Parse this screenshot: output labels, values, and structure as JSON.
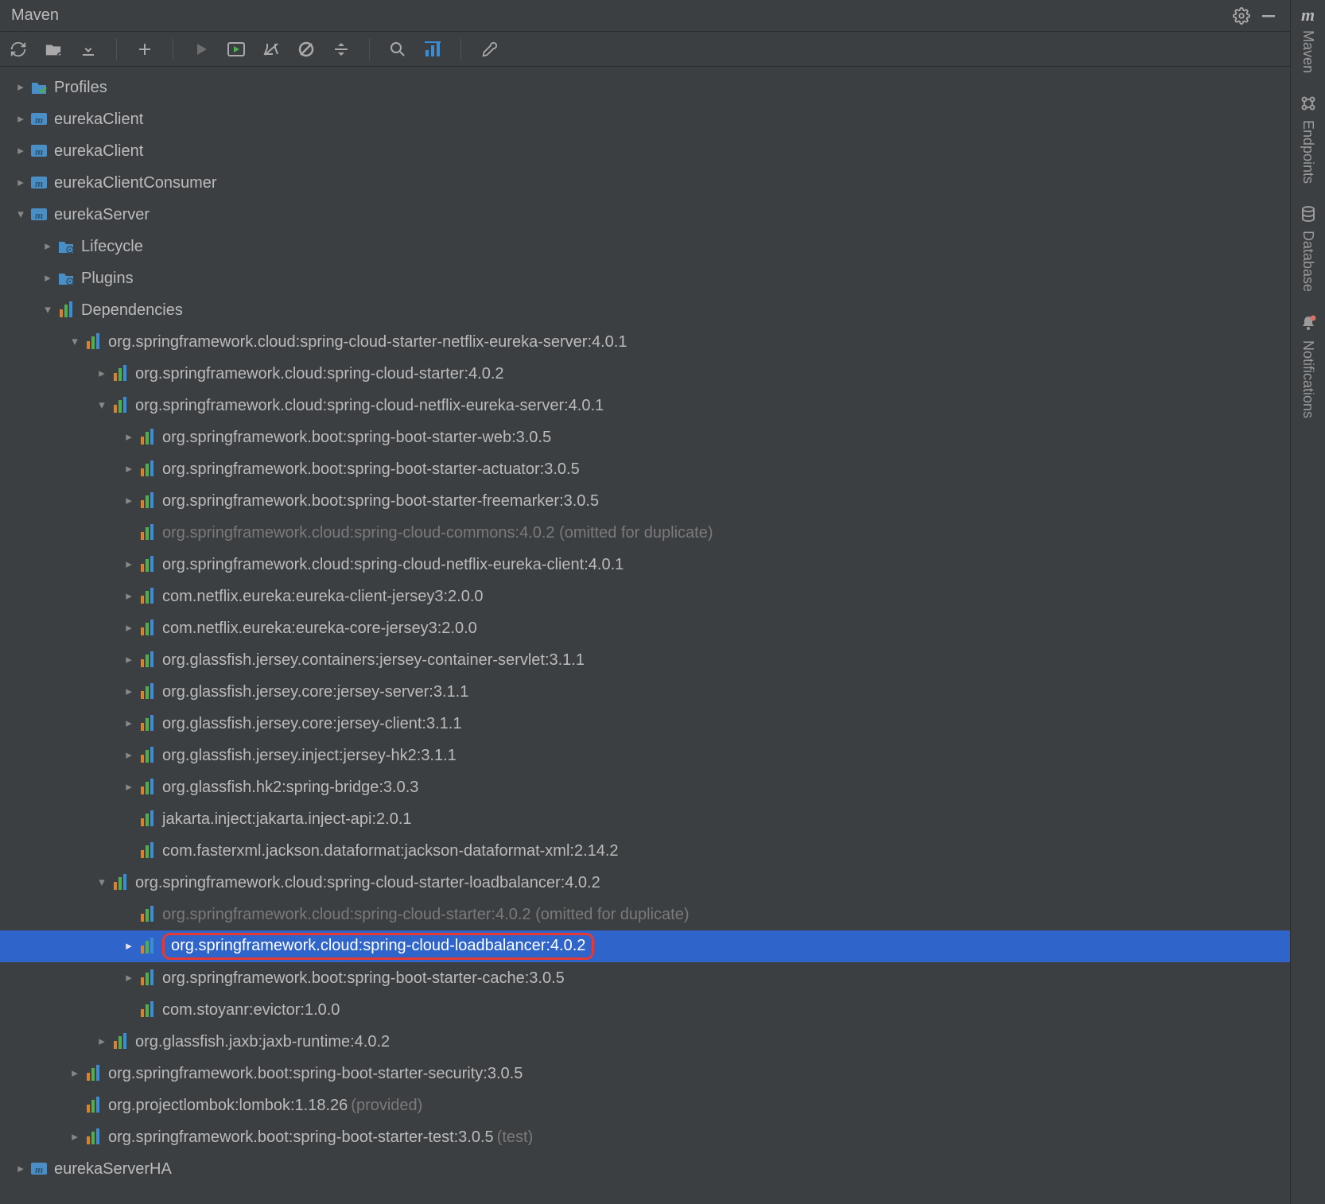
{
  "panel": {
    "title": "Maven"
  },
  "rightbar": {
    "tabs": [
      "Maven",
      "Endpoints",
      "Database",
      "Notifications"
    ]
  },
  "tree": [
    {
      "depth": 0,
      "arrow": "right",
      "icon": "folder-check",
      "label": "Profiles"
    },
    {
      "depth": 0,
      "arrow": "right",
      "icon": "maven-module",
      "label": "eurekaClient"
    },
    {
      "depth": 0,
      "arrow": "right",
      "icon": "maven-module",
      "label": "eurekaClient"
    },
    {
      "depth": 0,
      "arrow": "right",
      "icon": "maven-module",
      "label": "eurekaClientConsumer"
    },
    {
      "depth": 0,
      "arrow": "down",
      "icon": "maven-module",
      "label": "eurekaServer"
    },
    {
      "depth": 1,
      "arrow": "right",
      "icon": "folder-gear",
      "label": "Lifecycle"
    },
    {
      "depth": 1,
      "arrow": "right",
      "icon": "folder-gear",
      "label": "Plugins"
    },
    {
      "depth": 1,
      "arrow": "down",
      "icon": "bars",
      "label": "Dependencies"
    },
    {
      "depth": 2,
      "arrow": "down",
      "icon": "bars",
      "label": "org.springframework.cloud:spring-cloud-starter-netflix-eureka-server:4.0.1"
    },
    {
      "depth": 3,
      "arrow": "right",
      "icon": "bars",
      "label": "org.springframework.cloud:spring-cloud-starter:4.0.2"
    },
    {
      "depth": 3,
      "arrow": "down",
      "icon": "bars",
      "label": "org.springframework.cloud:spring-cloud-netflix-eureka-server:4.0.1"
    },
    {
      "depth": 4,
      "arrow": "right",
      "icon": "bars",
      "label": "org.springframework.boot:spring-boot-starter-web:3.0.5"
    },
    {
      "depth": 4,
      "arrow": "right",
      "icon": "bars",
      "label": "org.springframework.boot:spring-boot-starter-actuator:3.0.5"
    },
    {
      "depth": 4,
      "arrow": "right",
      "icon": "bars",
      "label": "org.springframework.boot:spring-boot-starter-freemarker:3.0.5"
    },
    {
      "depth": 4,
      "arrow": "blank",
      "icon": "bars",
      "label": "org.springframework.cloud:spring-cloud-commons:4.0.2 (omitted for duplicate)",
      "dimmed": true
    },
    {
      "depth": 4,
      "arrow": "right",
      "icon": "bars",
      "label": "org.springframework.cloud:spring-cloud-netflix-eureka-client:4.0.1"
    },
    {
      "depth": 4,
      "arrow": "right",
      "icon": "bars",
      "label": "com.netflix.eureka:eureka-client-jersey3:2.0.0"
    },
    {
      "depth": 4,
      "arrow": "right",
      "icon": "bars",
      "label": "com.netflix.eureka:eureka-core-jersey3:2.0.0"
    },
    {
      "depth": 4,
      "arrow": "right",
      "icon": "bars",
      "label": "org.glassfish.jersey.containers:jersey-container-servlet:3.1.1"
    },
    {
      "depth": 4,
      "arrow": "right",
      "icon": "bars",
      "label": "org.glassfish.jersey.core:jersey-server:3.1.1"
    },
    {
      "depth": 4,
      "arrow": "right",
      "icon": "bars",
      "label": "org.glassfish.jersey.core:jersey-client:3.1.1"
    },
    {
      "depth": 4,
      "arrow": "right",
      "icon": "bars",
      "label": "org.glassfish.jersey.inject:jersey-hk2:3.1.1"
    },
    {
      "depth": 4,
      "arrow": "right",
      "icon": "bars",
      "label": "org.glassfish.hk2:spring-bridge:3.0.3"
    },
    {
      "depth": 4,
      "arrow": "blank",
      "icon": "bars",
      "label": "jakarta.inject:jakarta.inject-api:2.0.1"
    },
    {
      "depth": 4,
      "arrow": "blank",
      "icon": "bars",
      "label": "com.fasterxml.jackson.dataformat:jackson-dataformat-xml:2.14.2"
    },
    {
      "depth": 3,
      "arrow": "down",
      "icon": "bars",
      "label": "org.springframework.cloud:spring-cloud-starter-loadbalancer:4.0.2"
    },
    {
      "depth": 4,
      "arrow": "blank",
      "icon": "bars",
      "label": "org.springframework.cloud:spring-cloud-starter:4.0.2 (omitted for duplicate)",
      "dimmed": true
    },
    {
      "depth": 4,
      "arrow": "right",
      "icon": "bars",
      "label": "org.springframework.cloud:spring-cloud-loadbalancer:4.0.2",
      "selected": true,
      "highlight": true
    },
    {
      "depth": 4,
      "arrow": "right",
      "icon": "bars",
      "label": "org.springframework.boot:spring-boot-starter-cache:3.0.5"
    },
    {
      "depth": 4,
      "arrow": "blank",
      "icon": "bars",
      "label": "com.stoyanr:evictor:1.0.0"
    },
    {
      "depth": 3,
      "arrow": "right",
      "icon": "bars",
      "label": "org.glassfish.jaxb:jaxb-runtime:4.0.2"
    },
    {
      "depth": 2,
      "arrow": "right",
      "icon": "bars",
      "label": "org.springframework.boot:spring-boot-starter-security:3.0.5"
    },
    {
      "depth": 2,
      "arrow": "blank",
      "icon": "bars",
      "label": "org.projectlombok:lombok:1.18.26",
      "suffix": " (provided)"
    },
    {
      "depth": 2,
      "arrow": "right",
      "icon": "bars",
      "label": "org.springframework.boot:spring-boot-starter-test:3.0.5",
      "suffix": " (test)"
    },
    {
      "depth": 0,
      "arrow": "right",
      "icon": "maven-module",
      "label": "eurekaServerHA"
    }
  ]
}
